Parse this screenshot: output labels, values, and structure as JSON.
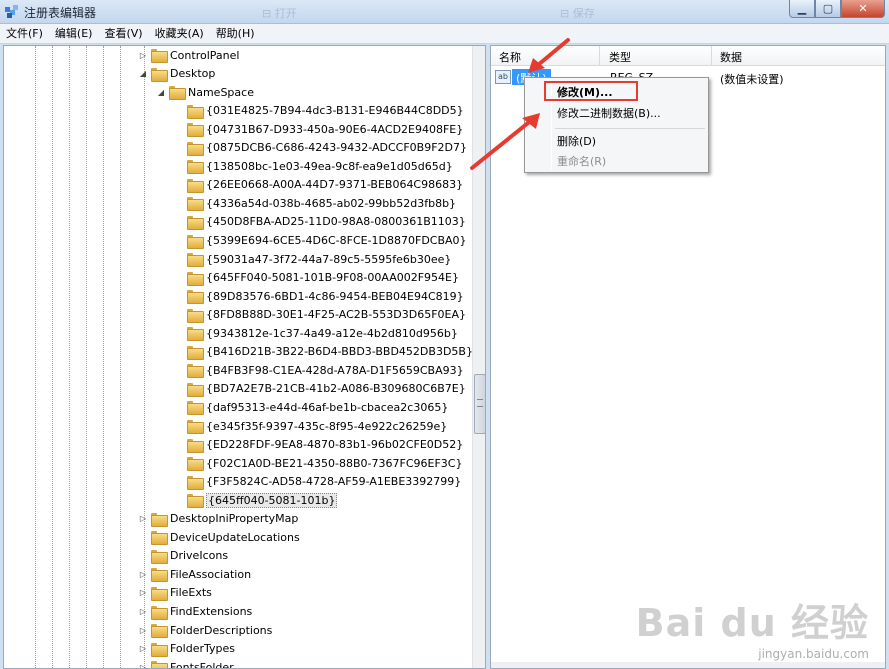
{
  "window": {
    "title": "注册表编辑器",
    "ghost_labels": [
      "⊟ 打开",
      "⊟ 保存"
    ],
    "buttons": {
      "minimize": "▁",
      "maximize": "▢",
      "close": "✕"
    }
  },
  "menubar": {
    "items": [
      "文件(F)",
      "编辑(E)",
      "查看(V)",
      "收藏夹(A)",
      "帮助(H)"
    ]
  },
  "tree": {
    "rows": [
      {
        "label": "ControlPanel",
        "expander": "▷"
      },
      {
        "label": "Desktop",
        "expander": "◢"
      },
      {
        "label": "NameSpace",
        "expander": "◢"
      },
      {
        "label": "{031E4825-7B94-4dc3-B131-E946B44C8DD5}",
        "expander": ""
      },
      {
        "label": "{04731B67-D933-450a-90E6-4ACD2E9408FE}",
        "expander": ""
      },
      {
        "label": "{0875DCB6-C686-4243-9432-ADCCF0B9F2D7}",
        "expander": ""
      },
      {
        "label": "{138508bc-1e03-49ea-9c8f-ea9e1d05d65d}",
        "expander": ""
      },
      {
        "label": "{26EE0668-A00A-44D7-9371-BEB064C98683}",
        "expander": ""
      },
      {
        "label": "{4336a54d-038b-4685-ab02-99bb52d3fb8b}",
        "expander": ""
      },
      {
        "label": "{450D8FBA-AD25-11D0-98A8-0800361B1103}",
        "expander": ""
      },
      {
        "label": "{5399E694-6CE5-4D6C-8FCE-1D8870FDCBA0}",
        "expander": ""
      },
      {
        "label": "{59031a47-3f72-44a7-89c5-5595fe6b30ee}",
        "expander": ""
      },
      {
        "label": "{645FF040-5081-101B-9F08-00AA002F954E}",
        "expander": ""
      },
      {
        "label": "{89D83576-6BD1-4c86-9454-BEB04E94C819}",
        "expander": ""
      },
      {
        "label": "{8FD8B88D-30E1-4F25-AC2B-553D3D65F0EA}",
        "expander": ""
      },
      {
        "label": "{9343812e-1c37-4a49-a12e-4b2d810d956b}",
        "expander": ""
      },
      {
        "label": "{B416D21B-3B22-B6D4-BBD3-BBD452DB3D5B}",
        "expander": ""
      },
      {
        "label": "{B4FB3F98-C1EA-428d-A78A-D1F5659CBA93}",
        "expander": ""
      },
      {
        "label": "{BD7A2E7B-21CB-41b2-A086-B309680C6B7E}",
        "expander": ""
      },
      {
        "label": "{daf95313-e44d-46af-be1b-cbacea2c3065}",
        "expander": ""
      },
      {
        "label": "{e345f35f-9397-435c-8f95-4e922c26259e}",
        "expander": ""
      },
      {
        "label": "{ED228FDF-9EA8-4870-83b1-96b02CFE0D52}",
        "expander": ""
      },
      {
        "label": "{F02C1A0D-BE21-4350-88B0-7367FC96EF3C}",
        "expander": ""
      },
      {
        "label": "{F3F5824C-AD58-4728-AF59-A1EBE3392799}",
        "expander": ""
      },
      {
        "label": "{645ff040-5081-101b}",
        "expander": "",
        "selected": true
      },
      {
        "label": "DesktopIniPropertyMap",
        "expander": "▷"
      },
      {
        "label": "DeviceUpdateLocations",
        "expander": ""
      },
      {
        "label": "DriveIcons",
        "expander": ""
      },
      {
        "label": "FileAssociation",
        "expander": "▷"
      },
      {
        "label": "FileExts",
        "expander": "▷"
      },
      {
        "label": "FindExtensions",
        "expander": "▷"
      },
      {
        "label": "FolderDescriptions",
        "expander": "▷"
      },
      {
        "label": "FolderTypes",
        "expander": "▷"
      },
      {
        "label": "FontsFolder",
        "expander": "▷"
      }
    ]
  },
  "list": {
    "columns": [
      "名称",
      "类型",
      "数据"
    ],
    "rows": [
      {
        "icon": "ab",
        "name": "(默认)",
        "type": "REG_SZ",
        "data": "(数值未设置)"
      }
    ]
  },
  "context_menu": {
    "items": [
      {
        "label": "修改(M)...",
        "style": "bold"
      },
      {
        "label": "修改二进制数据(B)...",
        "style": "normal"
      },
      {
        "label": "删除(D)",
        "style": "normal"
      },
      {
        "label": "重命名(R)",
        "style": "disabled"
      }
    ]
  },
  "watermark": {
    "logo": "Bai du 经验",
    "url": "jingyan.baidu.com"
  },
  "colors": {
    "selection": "#3399ff",
    "annotation_red": "#e53b30",
    "folder_yellow": "#f8dc84"
  }
}
